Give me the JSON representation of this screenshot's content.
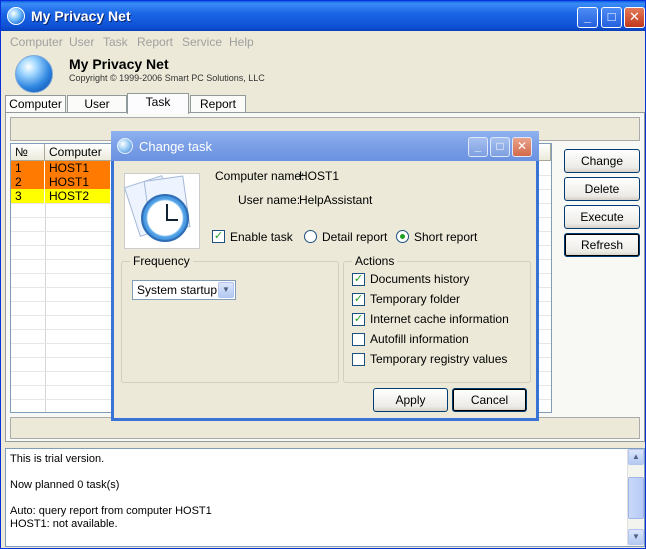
{
  "window": {
    "title": "My Privacy Net"
  },
  "menu": [
    "Computer",
    "User",
    "Task",
    "Report",
    "Service",
    "Help"
  ],
  "header": {
    "app_name": "My Privacy Net",
    "copyright": "Copyright © 1999-2006 Smart PC Solutions, LLC"
  },
  "tabs": [
    {
      "label": "Computer",
      "active": false
    },
    {
      "label": "User",
      "active": false
    },
    {
      "label": "Task",
      "active": true
    },
    {
      "label": "Report",
      "active": false
    }
  ],
  "grid": {
    "columns": [
      "№",
      "Computer"
    ],
    "rows": [
      {
        "num": "1",
        "computer": "HOST1",
        "color": "#ff7a00"
      },
      {
        "num": "2",
        "computer": "HOST1",
        "color": "#ff7a00"
      },
      {
        "num": "3",
        "computer": "HOST2",
        "color": "#ffff00"
      }
    ]
  },
  "side_buttons": {
    "change": "Change",
    "delete": "Delete",
    "execute": "Execute",
    "refresh": "Refresh"
  },
  "log": [
    "This is trial version.",
    "",
    "Now planned 0 task(s)",
    "",
    "Auto: query report from computer HOST1",
    "HOST1: not available."
  ],
  "dialog": {
    "title": "Change task",
    "computer_name_label": "Computer name:",
    "computer_name": "HOST1",
    "user_name_label": "User name:",
    "user_name": "HelpAssistant",
    "enable_task": {
      "label": "Enable task",
      "checked": true
    },
    "report_options": [
      {
        "label": "Detail report",
        "selected": false
      },
      {
        "label": "Short report",
        "selected": true
      }
    ],
    "frequency": {
      "title": "Frequency",
      "selected": "System startup"
    },
    "actions": {
      "title": "Actions",
      "items": [
        {
          "label": "Documents history",
          "checked": true
        },
        {
          "label": "Temporary folder",
          "checked": true
        },
        {
          "label": "Internet cache information",
          "checked": true
        },
        {
          "label": "Autofill information",
          "checked": false
        },
        {
          "label": "Temporary registry values",
          "checked": false
        }
      ]
    },
    "apply": "Apply",
    "cancel": "Cancel"
  }
}
